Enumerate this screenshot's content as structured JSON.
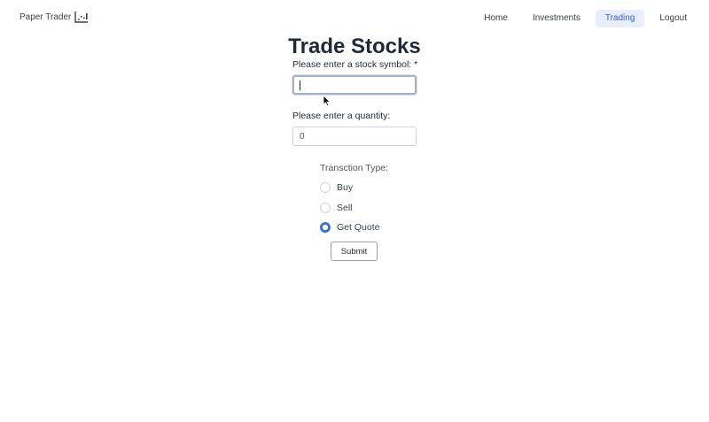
{
  "brand": {
    "name": "Paper Trader",
    "icon": "chart-icon"
  },
  "nav": {
    "items": [
      {
        "label": "Home",
        "active": false
      },
      {
        "label": "Investments",
        "active": false
      },
      {
        "label": "Trading",
        "active": true
      },
      {
        "label": "Logout",
        "active": false
      }
    ]
  },
  "main": {
    "title": "Trade Stocks",
    "symbol": {
      "label": "Please enter a stock symbol: *",
      "value": "",
      "placeholder": ""
    },
    "quantity": {
      "label": "Please enter a quantity:",
      "value": "0"
    },
    "transaction": {
      "label": "Transction Type:",
      "options": [
        {
          "label": "Buy",
          "checked": false
        },
        {
          "label": "Sell",
          "checked": false
        },
        {
          "label": "Get Quote",
          "checked": true
        }
      ]
    },
    "submit_label": "Submit"
  },
  "colors": {
    "accent": "#3b6fd1",
    "active_nav_bg": "#e8eefb",
    "active_nav_text": "#3b5cc9"
  }
}
